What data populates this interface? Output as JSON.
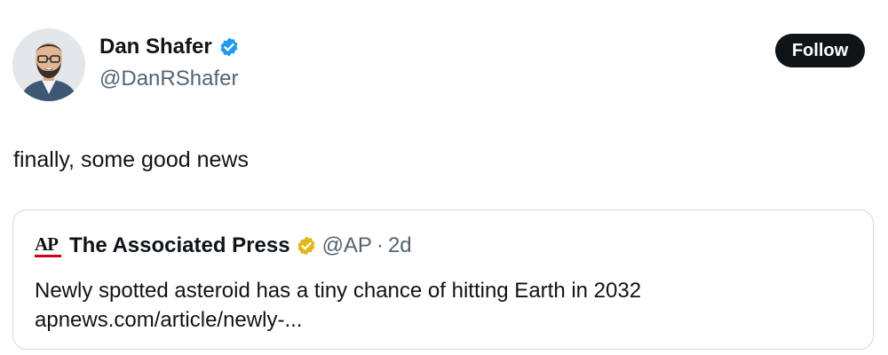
{
  "author": {
    "display_name": "Dan Shafer",
    "handle": "@DanRShafer",
    "avatar_icon": "person-photo-avatar",
    "verified_icon": "blue-verified-badge-icon",
    "verified_color": "#1d9bf0"
  },
  "follow_button": {
    "label": "Follow",
    "background": "#0f1419"
  },
  "tweet": {
    "text": "finally, some good news"
  },
  "quote": {
    "logo_text": "AP",
    "logo_icon": "ap-logo",
    "display_name": "The Associated Press",
    "verified_icon": "gold-verified-badge-icon",
    "verified_color": "#e2b719",
    "handle": "@AP",
    "separator": "·",
    "time": "2d",
    "headline": "Newly spotted asteroid has a tiny chance of hitting Earth in 2032",
    "link": "apnews.com/article/newly-..."
  },
  "colors": {
    "text_primary": "#0f1419",
    "text_secondary": "#536471",
    "border": "#cfd9de",
    "ap_red": "#d0021b"
  }
}
